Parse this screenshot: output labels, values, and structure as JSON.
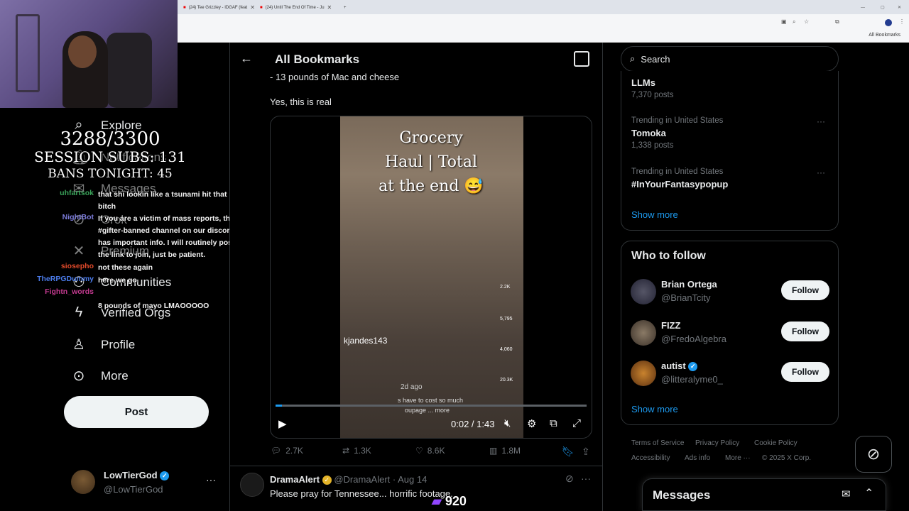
{
  "browser": {
    "tabs": [
      {
        "label": "(24) Tee Grizzley - IDGAF (feat"
      },
      {
        "label": "(24) Until The End Of Time - Ju"
      }
    ],
    "bookmarks_bar_item": "All Bookmarks"
  },
  "overlay": {
    "sub_count": "3288/3300",
    "session_subs": "SESSION SUBS: 131",
    "bans": "BANS TONIGHT: 45",
    "chat": [
      {
        "user": "uhfartsok",
        "color": "#3aa35a",
        "msg": "that shi lookin like a tsunami hit that bitch"
      },
      {
        "user": "NightBot",
        "color": "#7b7bd9",
        "msg": "If you are a victim of mass reports, the #gifter-banned channel on our discord has important info. I will routinely post the link to join, just be patient."
      },
      {
        "user": "siosepho",
        "color": "#e24a2a",
        "msg": "not these again"
      },
      {
        "user": "TheRPGDummy",
        "color": "#4b7bea",
        "msg": "here we go"
      },
      {
        "user": "Fightn_words",
        "color": "#c23a8f",
        "msg": ""
      },
      {
        "user": "",
        "color": "#3aa35a",
        "msg": "8 pounds of mayo LMAOOOOO"
      }
    ],
    "viewer_count": "920"
  },
  "nav": {
    "explore": "Explore",
    "notifications": "Notifications",
    "messages": "Messages",
    "grok": "Grok",
    "premium": "Premium",
    "communities": "Communities",
    "verified_orgs": "Verified Orgs",
    "profile": "Profile",
    "more": "More",
    "post": "Post"
  },
  "account": {
    "name": "LowTierGod",
    "handle": "@LowTierGod"
  },
  "header": {
    "title": "All Bookmarks"
  },
  "tweet": {
    "text_line1": "- 13 pounds of Mac and cheese",
    "text_line2": "Yes, this is real",
    "video": {
      "overlay_title_1": "Grocery",
      "overlay_title_2": "Haul | Total",
      "overlay_title_3": "at the end 😅",
      "creator": "kjandes143",
      "age": "2d ago",
      "caption": "s have to cost so much",
      "caption_more": "oupage ... more",
      "side_counts": [
        "2.2K",
        "5,795",
        "4,060",
        "20.3K"
      ],
      "time": "0:02 / 1:43",
      "progress": 0.02
    },
    "stats": {
      "replies": "2.7K",
      "reposts": "1.3K",
      "likes": "8.6K",
      "views": "1.8M"
    }
  },
  "next_tweet": {
    "name": "DramaAlert",
    "handle": "@DramaAlert",
    "date": "· Aug 14",
    "text": "Please pray for Tennessee... horrific footage."
  },
  "sidebar": {
    "search_placeholder": "Search",
    "trends": [
      {
        "kicker": "",
        "name": "LLMs",
        "count": "7,370 posts"
      },
      {
        "kicker": "Trending in United States",
        "name": "Tomoka",
        "count": "1,338 posts"
      },
      {
        "kicker": "Trending in United States",
        "name": "#InYourFantasypopup",
        "count": ""
      }
    ],
    "trends_show_more": "Show more",
    "who_to_follow": {
      "title": "Who to follow",
      "accounts": [
        {
          "name": "Brian Ortega",
          "handle": "@BrianTcity",
          "button": "Follow"
        },
        {
          "name": "FIZZ",
          "handle": "@FredoAlgebra",
          "button": "Follow"
        },
        {
          "name": "autist",
          "handle": "@litteralyme0_",
          "button": "Follow"
        }
      ],
      "show_more": "Show more"
    },
    "footer": {
      "terms": "Terms of Service",
      "privacy": "Privacy Policy",
      "cookie": "Cookie Policy",
      "accessibility": "Accessibility",
      "ads": "Ads info",
      "more": "More ···",
      "copyright": "© 2025 X Corp."
    },
    "messages_title": "Messages"
  }
}
